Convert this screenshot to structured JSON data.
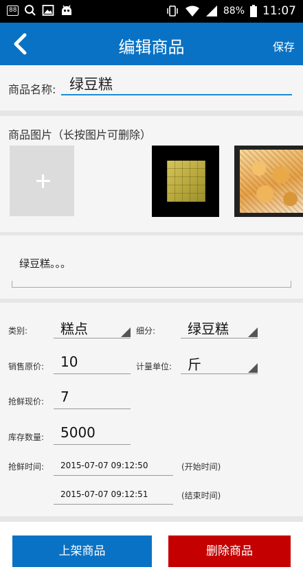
{
  "status_bar": {
    "badge": "88",
    "battery": "88%",
    "time": "11:07",
    "icons": [
      "search-icon",
      "image-icon",
      "android-icon",
      "vibrate-icon",
      "wifi-icon",
      "signal-icon",
      "battery-icon"
    ]
  },
  "header": {
    "title": "编辑商品",
    "save_label": "保存",
    "color": "#0a72c4"
  },
  "product": {
    "name_label": "商品名称:",
    "name_value": "绿豆糕"
  },
  "images": {
    "label": "商品图片（长按图片可删除）",
    "add_icon": "plus-icon"
  },
  "description": {
    "value": "绿豆糕。。。"
  },
  "form": {
    "category_label": "类别:",
    "category_value": "糕点",
    "subcategory_label": "细分:",
    "subcategory_value": "绿豆糕",
    "original_price_label": "销售原价:",
    "original_price_value": "10",
    "unit_label": "计量单位:",
    "unit_value": "斤",
    "current_price_label": "抢鲜现价:",
    "current_price_value": "7",
    "stock_label": "库存数量:",
    "stock_value": "5000",
    "time_label": "抢鲜时间:",
    "start_time": "2015-07-07 09:12:50",
    "start_note": "(开始时间)",
    "end_time": "2015-07-07 09:12:51",
    "end_note": "(结束时间)"
  },
  "actions": {
    "publish_label": "上架商品",
    "delete_label": "删除商品",
    "publish_color": "#0a72c4",
    "delete_color": "#c50000"
  }
}
